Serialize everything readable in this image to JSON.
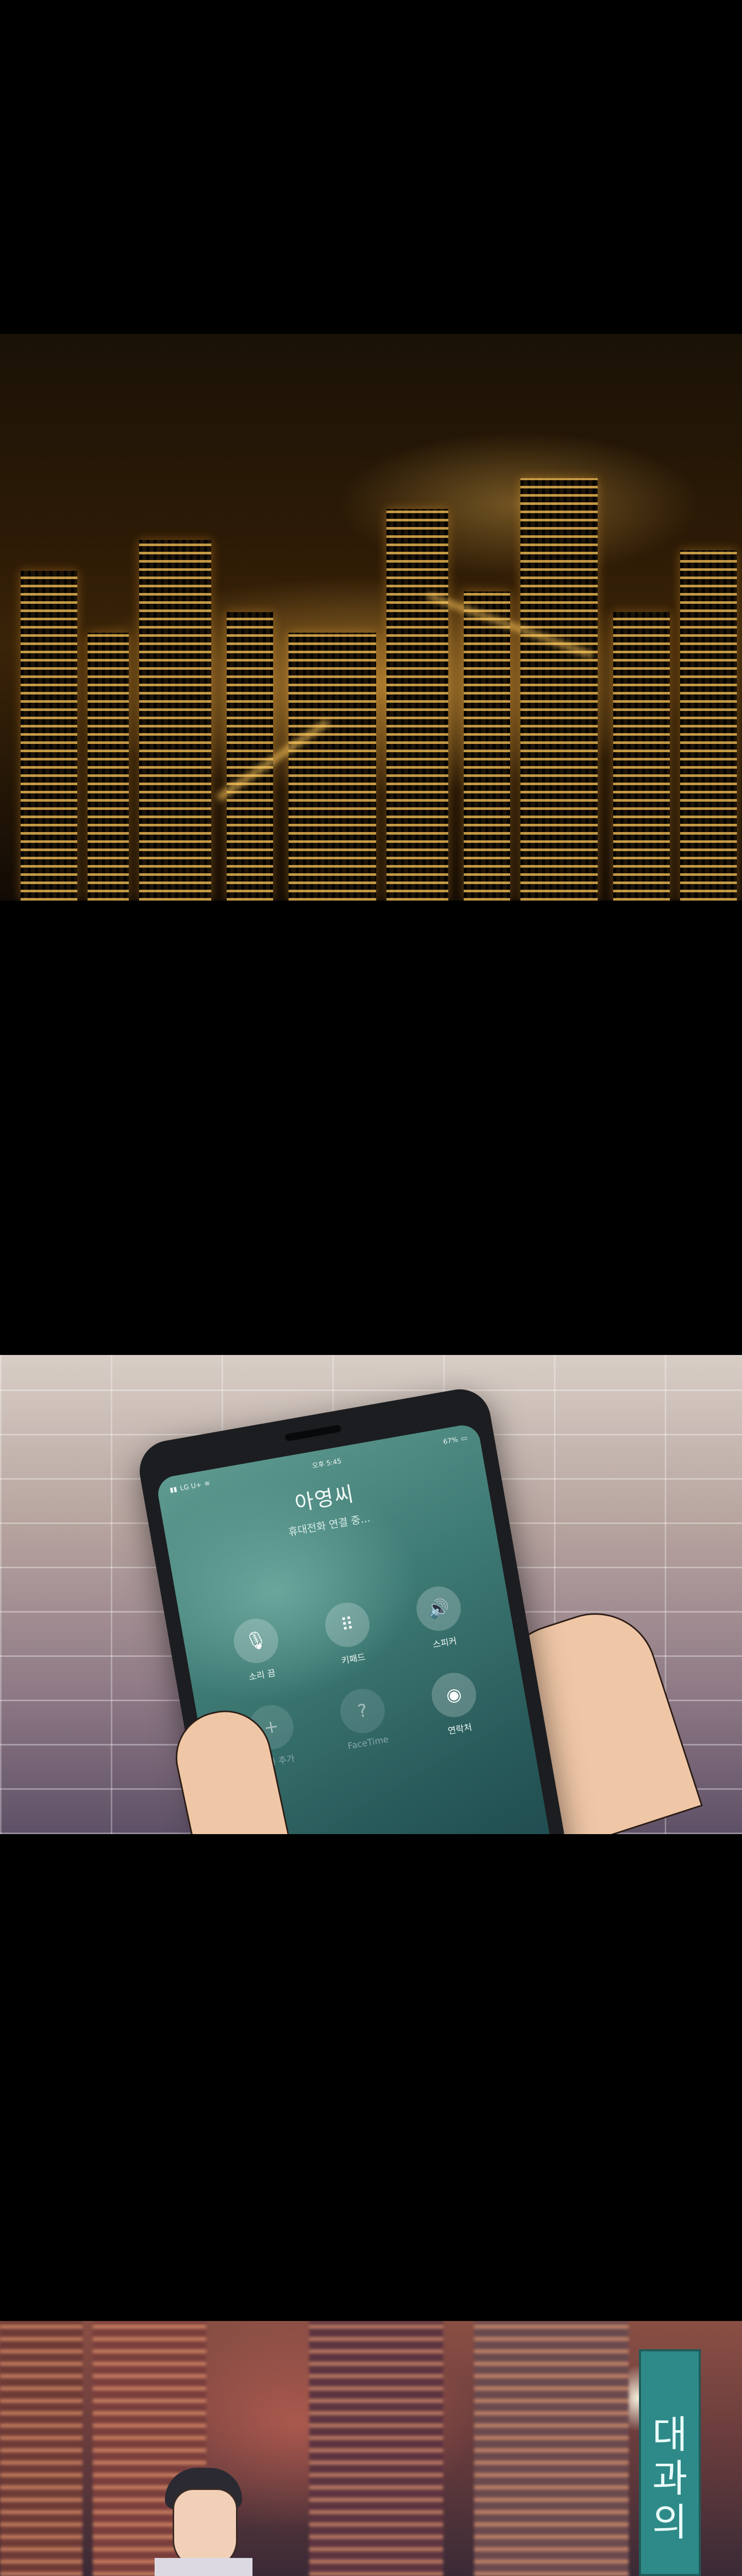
{
  "phone_call": {
    "status_bar": {
      "carrier": "LG U+",
      "time": "오후 5:45",
      "battery": "67%"
    },
    "caller_name": "아영씨",
    "call_status": "휴대전화 연결 중...",
    "buttons": [
      {
        "label": "소리 끔",
        "icon": "mic-off-icon",
        "symbol": "🎙",
        "disabled": false
      },
      {
        "label": "키패드",
        "icon": "keypad-icon",
        "symbol": "⠿",
        "disabled": false
      },
      {
        "label": "스피커",
        "icon": "speaker-icon",
        "symbol": "🔊",
        "disabled": false
      },
      {
        "label": "통화 추가",
        "icon": "add-call-icon",
        "symbol": "+",
        "disabled": true
      },
      {
        "label": "FaceTime",
        "icon": "facetime-icon",
        "symbol": "?",
        "disabled": true
      },
      {
        "label": "연락처",
        "icon": "contacts-icon",
        "symbol": "◉",
        "disabled": false
      }
    ],
    "end_call_color": "#e84a4a"
  },
  "street_sign": {
    "text": "대과의"
  },
  "colors": {
    "background": "#000000",
    "city_glow": "#ffbe50",
    "screen_teal": "#3e7a74",
    "sign_teal": "#2e8a88"
  }
}
